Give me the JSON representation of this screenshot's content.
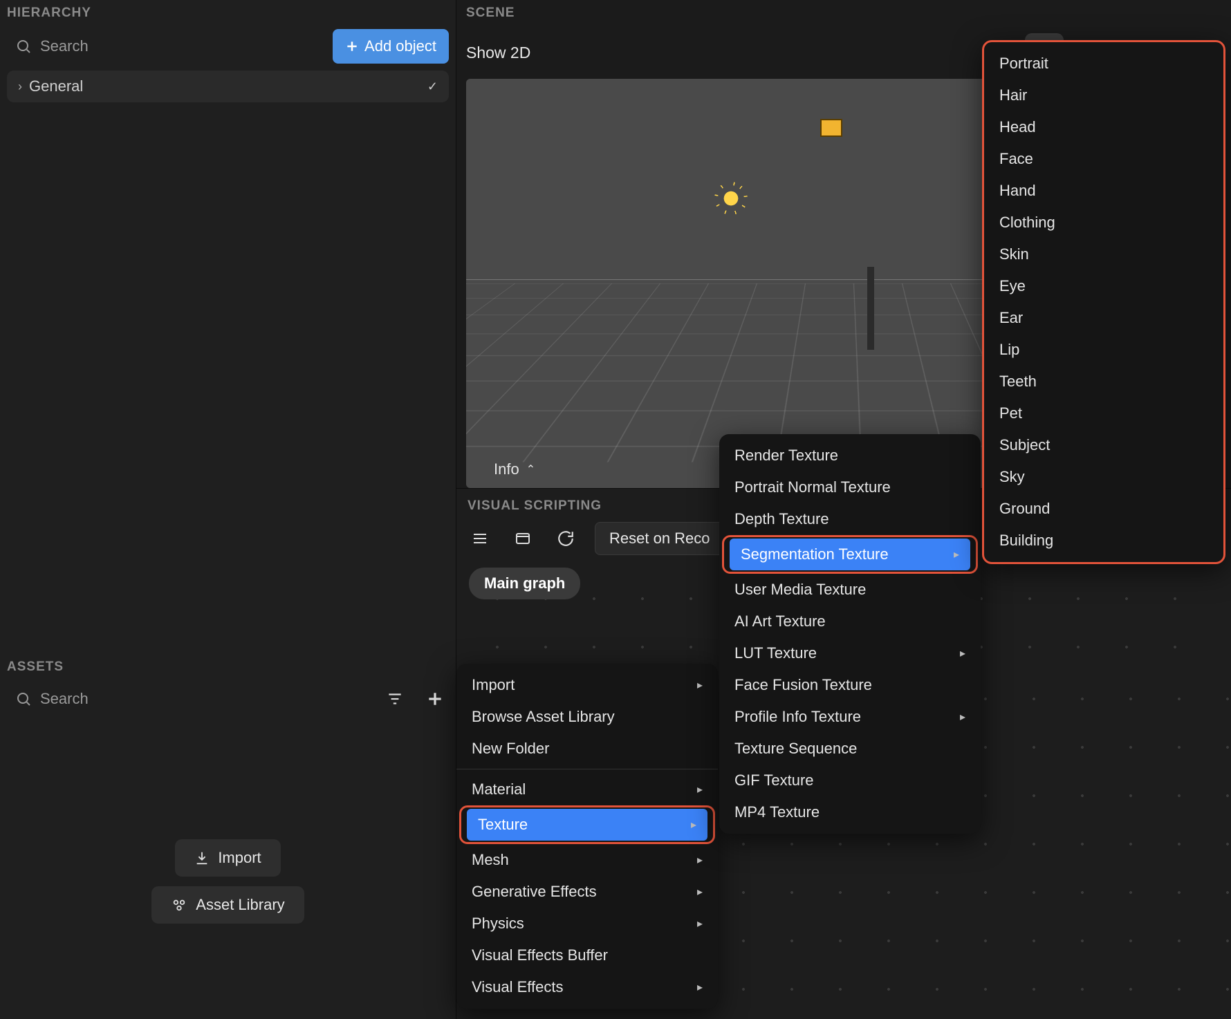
{
  "hierarchy": {
    "title": "HIERARCHY",
    "search_placeholder": "Search",
    "add_button": "Add object",
    "items": [
      {
        "label": "General"
      }
    ]
  },
  "scene": {
    "title": "SCENE",
    "show2d_label": "Show 2D",
    "info_label": "Info"
  },
  "visual_scripting": {
    "title": "VISUAL SCRIPTING",
    "reset_label": "Reset on Reco",
    "main_graph_label": "Main graph"
  },
  "assets": {
    "title": "ASSETS",
    "search_placeholder": "Search",
    "import_label": "Import",
    "asset_library_label": "Asset Library"
  },
  "context_menu_1": {
    "items": [
      {
        "label": "Import",
        "has_sub": true
      },
      {
        "label": "Browse Asset Library",
        "has_sub": false
      },
      {
        "label": "New Folder",
        "has_sub": false
      },
      {
        "sep": true
      },
      {
        "label": "Material",
        "has_sub": true
      },
      {
        "label": "Texture",
        "has_sub": true,
        "selected": true,
        "highlight": true
      },
      {
        "label": "Mesh",
        "has_sub": true
      },
      {
        "label": "Generative Effects",
        "has_sub": true
      },
      {
        "label": "Physics",
        "has_sub": true
      },
      {
        "label": "Visual Effects Buffer",
        "has_sub": false
      },
      {
        "label": "Visual Effects",
        "has_sub": true
      }
    ]
  },
  "context_menu_2": {
    "items": [
      {
        "label": "Render Texture"
      },
      {
        "label": "Portrait Normal Texture"
      },
      {
        "label": "Depth Texture"
      },
      {
        "label": "Segmentation Texture",
        "has_sub": true,
        "selected": true,
        "highlight": true
      },
      {
        "label": "User Media Texture"
      },
      {
        "label": "AI Art Texture"
      },
      {
        "label": "LUT Texture",
        "has_sub": true
      },
      {
        "label": "Face Fusion Texture"
      },
      {
        "label": "Profile Info Texture",
        "has_sub": true
      },
      {
        "label": "Texture Sequence"
      },
      {
        "label": "GIF Texture"
      },
      {
        "label": "MP4 Texture"
      }
    ]
  },
  "context_menu_3": {
    "highlight": true,
    "items": [
      {
        "label": "Portrait"
      },
      {
        "label": "Hair"
      },
      {
        "label": "Head"
      },
      {
        "label": "Face"
      },
      {
        "label": "Hand"
      },
      {
        "label": "Clothing"
      },
      {
        "label": "Skin"
      },
      {
        "label": "Eye"
      },
      {
        "label": "Ear"
      },
      {
        "label": "Lip"
      },
      {
        "label": "Teeth"
      },
      {
        "label": "Pet"
      },
      {
        "label": "Subject"
      },
      {
        "label": "Sky"
      },
      {
        "label": "Ground"
      },
      {
        "label": "Building"
      }
    ]
  }
}
